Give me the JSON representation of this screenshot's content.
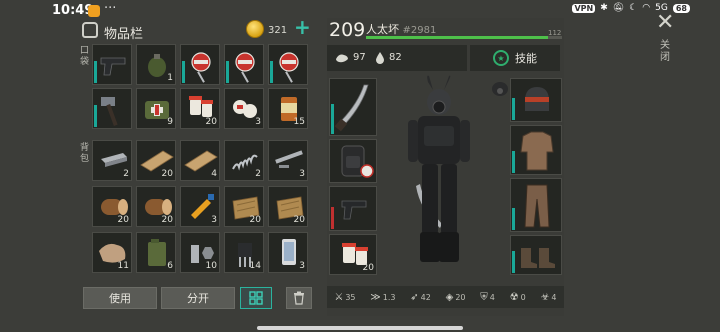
{
  "status": {
    "time": "10:49",
    "more": "···",
    "vpn": "VPN",
    "network": "5G",
    "battery": "68"
  },
  "inventory": {
    "title": "物品栏",
    "coins": "321",
    "add_symbol": "+",
    "pocket_label": "口袋",
    "backpack_label": "背包",
    "pocket_slots": [
      {
        "icon": "pistol-icon",
        "qty": ""
      },
      {
        "icon": "grenade-icon",
        "qty": "1"
      },
      {
        "icon": "forbidden-sign-icon",
        "qty": ""
      },
      {
        "icon": "forbidden-sign-icon",
        "qty": ""
      },
      {
        "icon": "forbidden-sign-icon",
        "qty": ""
      }
    ],
    "row2_slots": [
      {
        "icon": "sledgehammer-icon",
        "qty": ""
      },
      {
        "icon": "medical-kit-icon",
        "qty": "9"
      },
      {
        "icon": "pill-bottle-icon",
        "qty": "20"
      },
      {
        "icon": "bandage-icon",
        "qty": "3"
      },
      {
        "icon": "canned-food-icon",
        "qty": "15"
      }
    ],
    "backpack_rows": [
      [
        {
          "icon": "iron-bar-icon",
          "qty": "2"
        },
        {
          "icon": "wooden-plank-icon",
          "qty": "20"
        },
        {
          "icon": "wooden-plank-icon",
          "qty": "4"
        },
        {
          "icon": "spring-icon",
          "qty": "2"
        },
        {
          "icon": "metal-pipe-icon",
          "qty": "3"
        }
      ],
      [
        {
          "icon": "wood-log-icon",
          "qty": "20"
        },
        {
          "icon": "wood-log-icon",
          "qty": "20"
        },
        {
          "icon": "glue-tube-icon",
          "qty": "3"
        },
        {
          "icon": "fiber-bundle-icon",
          "qty": "20"
        },
        {
          "icon": "fiber-bundle-icon",
          "qty": "20"
        }
      ],
      [
        {
          "icon": "leather-scrap-icon",
          "qty": "11"
        },
        {
          "icon": "jerry-can-icon",
          "qty": "6"
        },
        {
          "icon": "bolt-nut-icon",
          "qty": "10"
        },
        {
          "icon": "electronic-chip-icon",
          "qty": "14"
        },
        {
          "icon": "smartphone-icon",
          "qty": "3"
        }
      ]
    ],
    "buttons": {
      "use": "使用",
      "split": "分开"
    }
  },
  "character": {
    "level": "209",
    "name": "人太坏",
    "id": "#2981",
    "xp_value": "112",
    "xp_fraction": 0.93,
    "food": "97",
    "water": "82",
    "skills_label": "技能",
    "equipped_weapon_qty": "",
    "armor_value_1": "20"
  },
  "bottom_stats": [
    {
      "icon": "melee-attack-icon",
      "value": "35"
    },
    {
      "icon": "attack-speed-icon",
      "value": "1.3"
    },
    {
      "icon": "ranged-attack-icon",
      "value": "42"
    },
    {
      "icon": "defense-icon",
      "value": "20"
    },
    {
      "icon": "armor-icon",
      "value": "4"
    },
    {
      "icon": "radiation-icon",
      "value": "0"
    },
    {
      "icon": "biohazard-icon",
      "value": "4"
    }
  ],
  "close_label": "关闭",
  "colors": {
    "accent_teal": "#1aa898",
    "xp_green": "#4ec04a",
    "coin_gold": "#d9a414"
  }
}
